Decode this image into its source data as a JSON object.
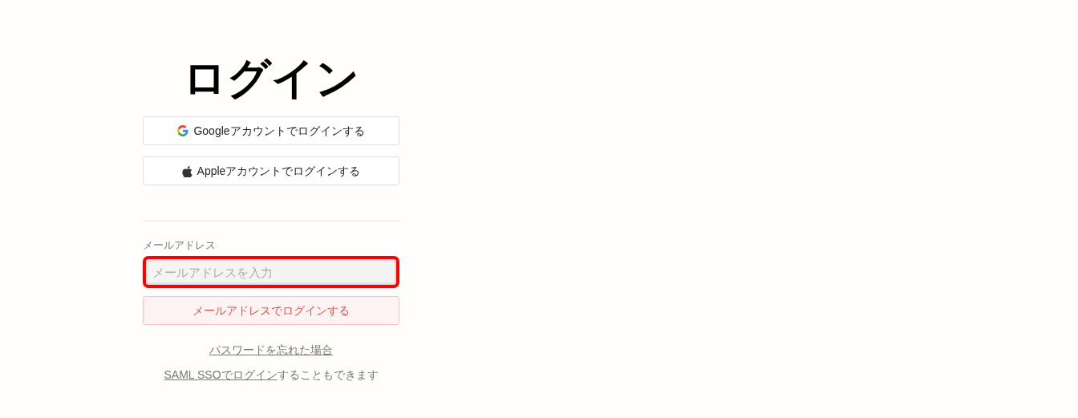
{
  "title": "ログイン",
  "social_buttons": [
    {
      "kind": "google",
      "label": "Googleアカウントでログインする"
    },
    {
      "kind": "apple",
      "label": "Appleアカウントでログインする"
    }
  ],
  "email": {
    "label": "メールアドレス",
    "placeholder": "メールアドレスを入力"
  },
  "submit_button": "メールアドレスでログインする",
  "forgot_link": "パスワードを忘れた場合",
  "sso": {
    "link": "SAML SSOでログイン",
    "rest": "することもできます"
  }
}
